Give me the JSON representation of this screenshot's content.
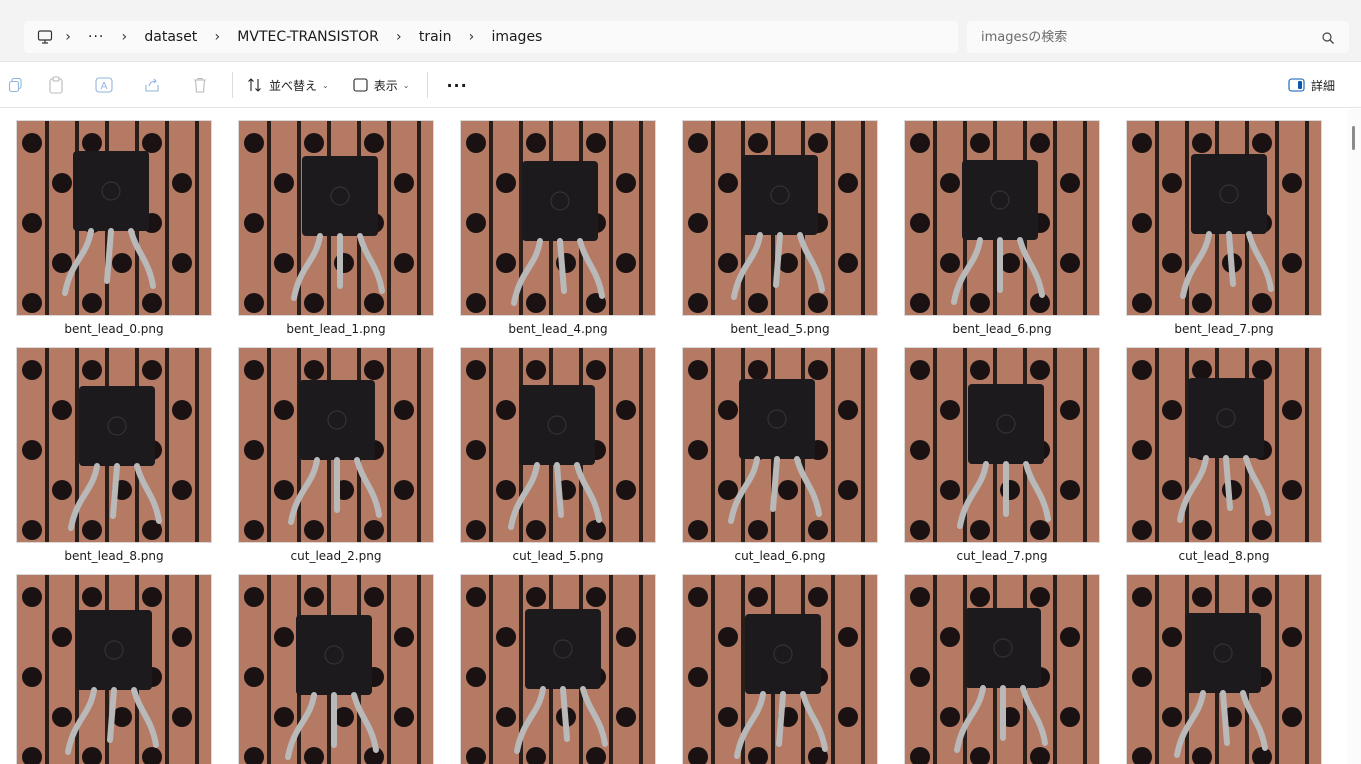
{
  "address": {
    "crumbs": [
      "dataset",
      "MVTEC-TRANSISTOR",
      "train",
      "images"
    ],
    "overflow": "···"
  },
  "search": {
    "placeholder": "imagesの検索"
  },
  "toolbar": {
    "sort_label": "並べ替え",
    "view_label": "表示",
    "more_label": "···",
    "details_label": "詳細"
  },
  "files": [
    {
      "name": "bent_lead_0.png"
    },
    {
      "name": "bent_lead_1.png"
    },
    {
      "name": "bent_lead_4.png"
    },
    {
      "name": "bent_lead_5.png"
    },
    {
      "name": "bent_lead_6.png"
    },
    {
      "name": "bent_lead_7.png"
    },
    {
      "name": "bent_lead_8.png"
    },
    {
      "name": "cut_lead_2.png"
    },
    {
      "name": "cut_lead_5.png"
    },
    {
      "name": "cut_lead_6.png"
    },
    {
      "name": "cut_lead_7.png"
    },
    {
      "name": "cut_lead_8.png"
    },
    {
      "name": ""
    },
    {
      "name": ""
    },
    {
      "name": ""
    },
    {
      "name": ""
    },
    {
      "name": ""
    },
    {
      "name": ""
    }
  ],
  "colors": {
    "board": "#b47a64",
    "stripe": "#2a1e1b",
    "hole": "#1a1212",
    "body": "#1c1a1c",
    "lead": "#b9b9b9"
  }
}
